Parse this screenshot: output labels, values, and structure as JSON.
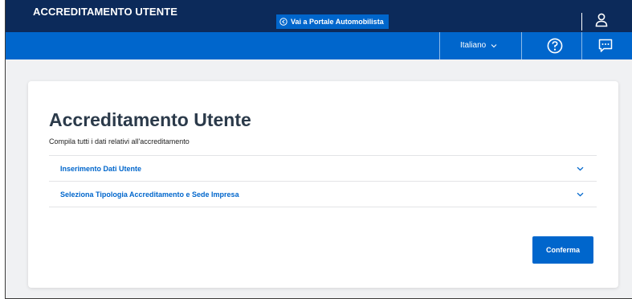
{
  "header": {
    "app_title": "ACCREDITAMENTO UTENTE",
    "portal_link": "Vai a Portale Automobilista",
    "user_icon": "user-icon"
  },
  "nav": {
    "language": "Italiano",
    "help_icon": "help-circle-icon",
    "chat_icon": "chat-bubble-icon"
  },
  "main": {
    "title": "Accreditamento Utente",
    "subtitle": "Compila tutti i dati relativi all'accreditamento",
    "accordion": [
      {
        "label": "Inserimento Dati Utente"
      },
      {
        "label": "Seleziona Tipologia Accreditamento e Sede Impresa"
      }
    ],
    "confirm_label": "Conferma"
  },
  "colors": {
    "top_bar": "#0c2a5a",
    "nav_bar": "#0066cc",
    "accent": "#0066cc",
    "background": "#f0f1f3"
  }
}
